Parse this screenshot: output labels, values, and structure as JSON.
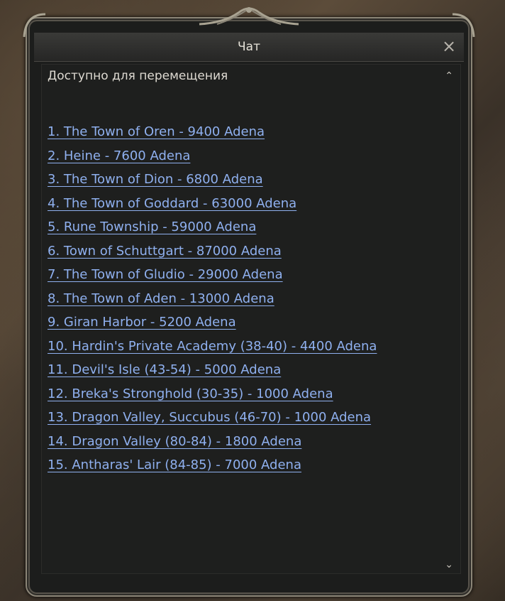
{
  "window": {
    "title": "Чат",
    "close_label": "×"
  },
  "content": {
    "heading": "Доступно для перемещения",
    "scroll_up": "⌃",
    "scroll_down": "⌄",
    "teleports": [
      "1. The Town of Oren - 9400 Adena",
      "2. Heine - 7600 Adena",
      "3. The Town of Dion - 6800 Adena",
      "4. The Town of Goddard - 63000 Adena",
      "5. Rune Township - 59000 Adena",
      "6. Town of Schuttgart - 87000 Adena",
      "7. The Town of Gludio - 29000 Adena",
      "8. The Town of Aden - 13000 Adena",
      "9. Giran Harbor - 5200 Adena",
      "10. Hardin's Private Academy (38-40) - 4400 Adena",
      "11. Devil's Isle (43-54) - 5000 Adena",
      "12. Breka's Stronghold (30-35) - 1000 Adena",
      "13. Dragon Valley, Succubus (46-70) - 1000 Adena",
      "14. Dragon Valley (80-84) - 1800 Adena",
      "15. Antharas' Lair (84-85) - 7000 Adena"
    ]
  },
  "colors": {
    "link": "#8fb0ef",
    "text": "#dedad2",
    "frame": "#8b8577"
  }
}
